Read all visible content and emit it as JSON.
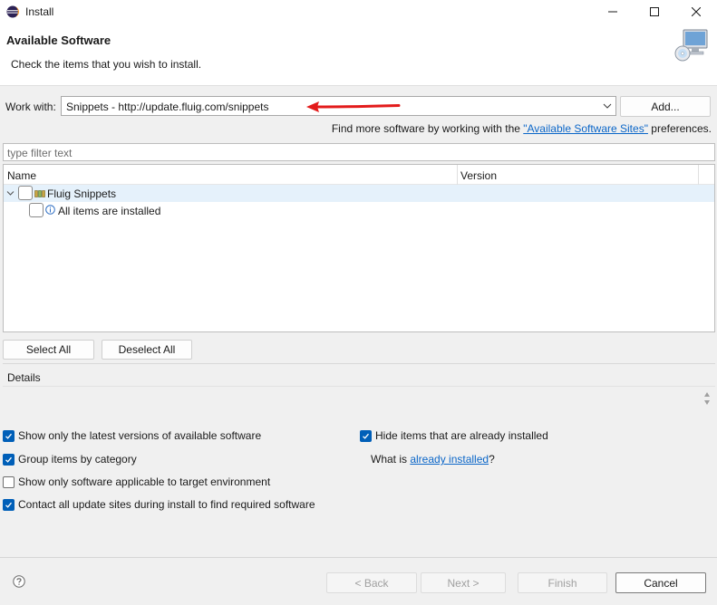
{
  "window": {
    "title": "Install",
    "controls": [
      "minimize-icon",
      "maximize-icon",
      "close-icon"
    ]
  },
  "header": {
    "title": "Available Software",
    "description": "Check the items that you wish to install.",
    "image_icon": "monitor-cd-icon"
  },
  "work_with": {
    "label": "Work with:",
    "value": "Snippets - http://update.fluig.com/snippets",
    "add_label": "Add..."
  },
  "find_more": {
    "prefix": "Find more software by working with the ",
    "link": "\"Available Software Sites\"",
    "suffix": " preferences."
  },
  "filter": {
    "placeholder": "type filter text"
  },
  "tree": {
    "columns": [
      "Name",
      "Version"
    ],
    "rows": [
      {
        "label": "Fluig Snippets",
        "version": "",
        "icon": "package-icon",
        "expanded": true,
        "checked": false
      },
      {
        "label": "All items are installed",
        "version": "",
        "icon": "info-icon",
        "checked": false
      }
    ]
  },
  "buttons": {
    "select_all": "Select All",
    "deselect_all": "Deselect All",
    "back": "< Back",
    "next": "Next >",
    "finish": "Finish",
    "cancel": "Cancel"
  },
  "details": {
    "label": "Details"
  },
  "options": {
    "latest_versions": {
      "label": "Show only the latest versions of available software",
      "checked": true
    },
    "group_by_category": {
      "label": "Group items by category",
      "checked": true
    },
    "target_environment": {
      "label": "Show only software applicable to target environment",
      "checked": false
    },
    "contact_update_sites": {
      "label": "Contact all update sites during install to find required software",
      "checked": true
    },
    "hide_installed": {
      "label": "Hide items that are already installed",
      "checked": true
    }
  },
  "what_is": {
    "prefix": "What is ",
    "link": "already installed",
    "suffix": "?"
  },
  "colors": {
    "accent": "#005fb8",
    "link": "#0b66c8",
    "arrow": "#e31b1b",
    "selection": "#e5f1fb"
  }
}
